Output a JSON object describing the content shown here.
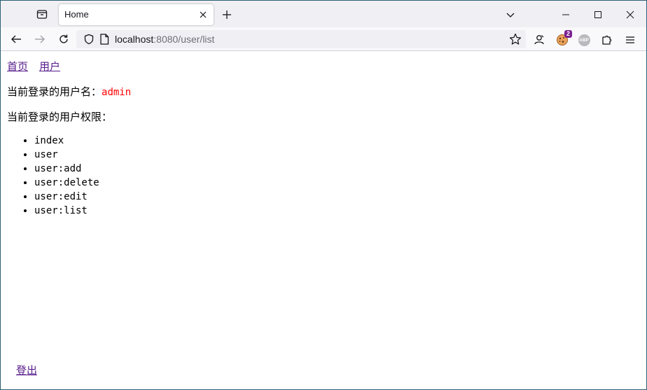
{
  "browser": {
    "tab_title": "Home",
    "url_host": "localhost",
    "url_rest": ":8080/user/list",
    "extension_badge": "2",
    "abp_label": "ABP"
  },
  "page": {
    "nav_links": [
      "首页",
      "用户"
    ],
    "username_label": "当前登录的用户名：",
    "username": "admin",
    "permissions_label": "当前登录的用户权限：",
    "permissions": [
      "index",
      "user",
      "user:add",
      "user:delete",
      "user:edit",
      "user:list"
    ],
    "logout": "登出",
    "link_color": "#551a8b",
    "username_color": "#ff0000"
  }
}
